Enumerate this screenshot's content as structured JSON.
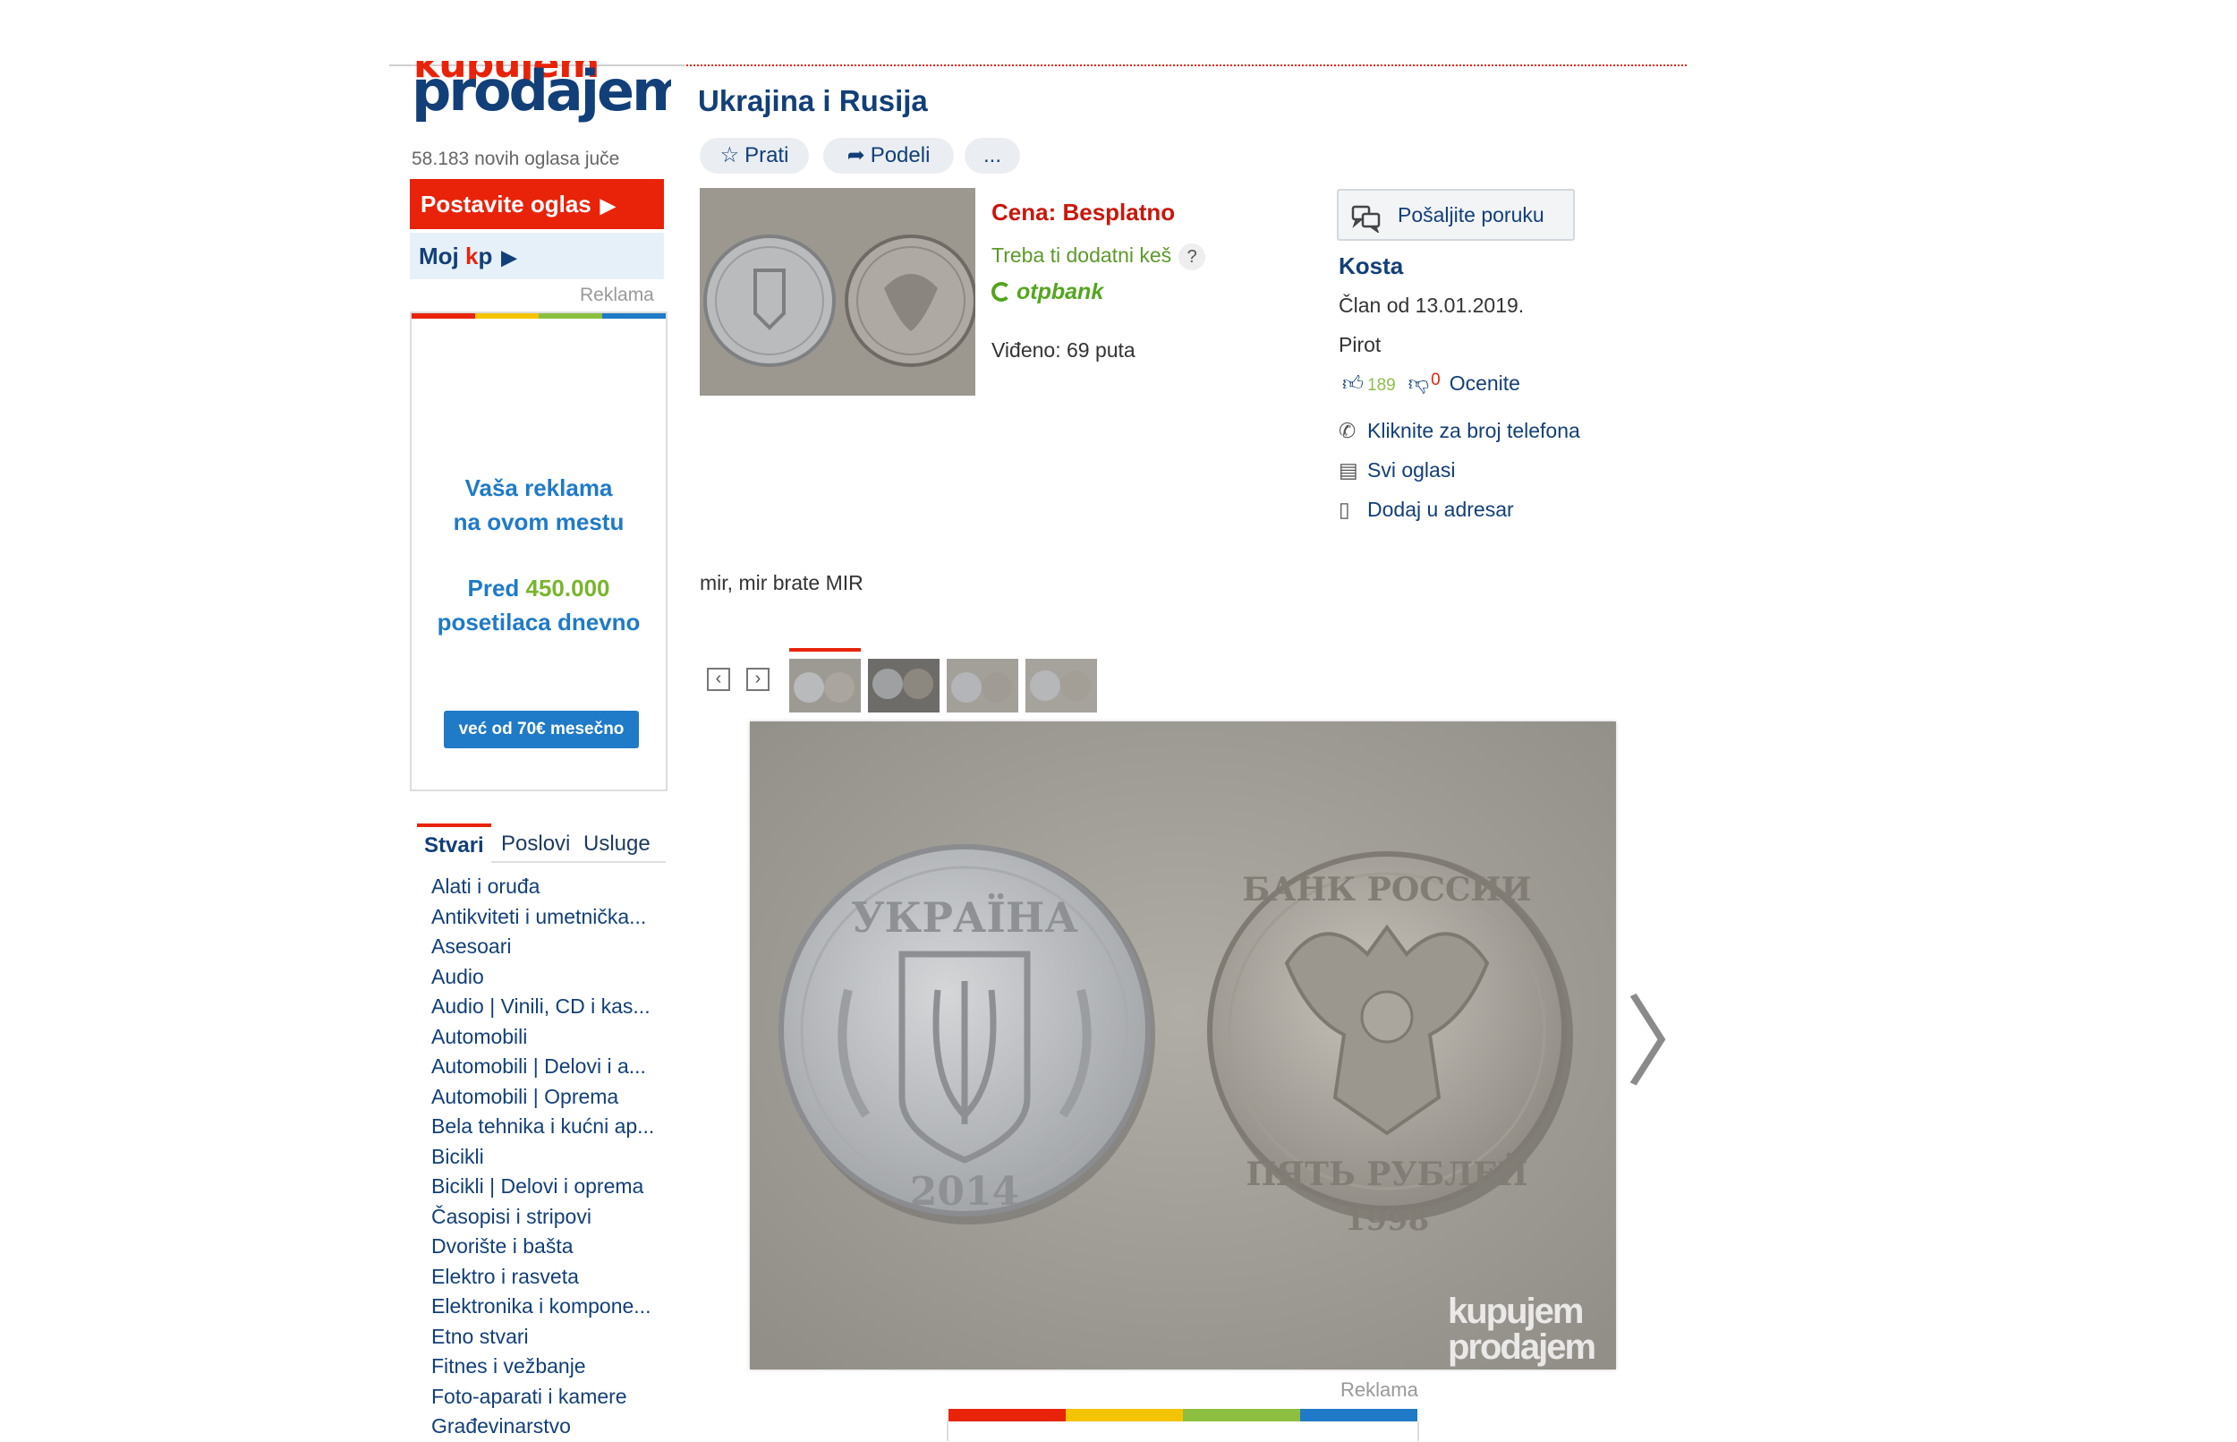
{
  "site": {
    "logo_top": "kupujem",
    "logo_main": "prodajem",
    "new_ads_text": "58.183 novih oglasa juče",
    "post_ad_label": "Postavite oglas",
    "moj_kp_prefix": "Moj ",
    "moj_kp_k": "k",
    "moj_kp_p": "p",
    "ad_label": "Reklama"
  },
  "promo": {
    "line1": "Vaša reklama",
    "line2": "na ovom mestu",
    "line3_prefix": "Pred ",
    "line3_number": "450.000",
    "line4": "posetilaca dnevno",
    "button": "već od 70€ mesečno"
  },
  "category_tabs": [
    "Stvari",
    "Poslovi",
    "Usluge"
  ],
  "categories": [
    "Alati i oruđa",
    "Antikviteti i umetnička...",
    "Asesoari",
    "Audio",
    "Audio | Vinili, CD i kas...",
    "Automobili",
    "Automobili | Delovi i a...",
    "Automobili | Oprema",
    "Bela tehnika i kućni ap...",
    "Bicikli",
    "Bicikli | Delovi i oprema",
    "Časopisi i stripovi",
    "Dvorište i bašta",
    "Elektro i rasveta",
    "Elektronika i kompone...",
    "Etno stvari",
    "Fitnes i vežbanje",
    "Foto-aparati i kamere",
    "Građevinarstvo"
  ],
  "listing": {
    "title": "Ukrajina i Rusija",
    "follow": "Prati",
    "share": "Podeli",
    "more": "...",
    "price": "Cena: Besplatno",
    "need_cash": "Treba ti dodatni keš",
    "help_mark": "?",
    "bank": "otpbank",
    "views": "Viđeno: 69 puta",
    "description": "mir, mir brate MIR",
    "thumb_count": 4,
    "active_thumb": 1
  },
  "seller": {
    "send_message": "Pošaljite poruku",
    "name": "Kosta",
    "member_since": "Član od 13.01.2019.",
    "city": "Pirot",
    "positive": "189",
    "negative": "0",
    "rate": "Ocenite",
    "phone_link": "Kliknite za broj telefona",
    "all_ads": "Svi oglasi",
    "add_contact": "Dodaj u adresar"
  },
  "photo": {
    "coin_left_top": "УКРАЇНА",
    "coin_left_year": "2014",
    "coin_right_top": "БАНК РОССИИ",
    "coin_right_bottom": "ПЯТЬ РУБЛЕЙ",
    "coin_right_year": "1998",
    "watermark_1": "kupujem",
    "watermark_2": "prodajem"
  },
  "colors": {
    "red": "#e8230a",
    "yellow": "#f5c400",
    "green": "#8cbf3f",
    "blue": "#1f7ac7",
    "navy": "#123f78"
  }
}
